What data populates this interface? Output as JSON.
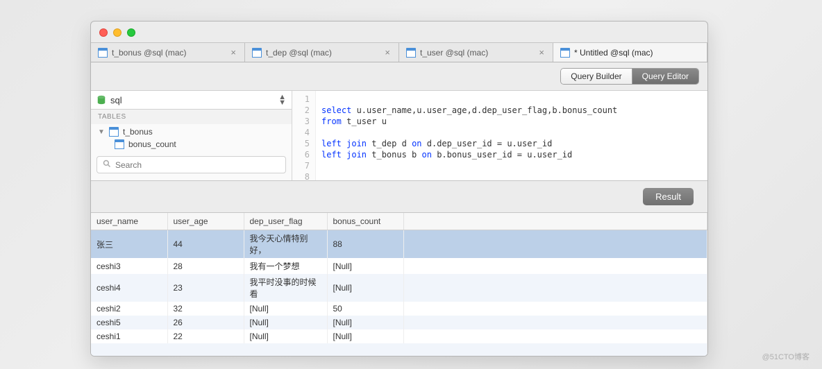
{
  "tabs": [
    {
      "label": "t_bonus @sql (mac)",
      "active": false
    },
    {
      "label": "t_dep @sql (mac)",
      "active": false
    },
    {
      "label": "t_user @sql (mac)",
      "active": false
    },
    {
      "label": "* Untitled @sql (mac)",
      "active": true
    }
  ],
  "toggle": {
    "builder": "Query Builder",
    "editor": "Query Editor"
  },
  "sidebar": {
    "db_name": "sql",
    "section": "TABLES",
    "nodes": {
      "parent": "t_bonus",
      "child": "bonus_count"
    },
    "search_placeholder": "Search"
  },
  "code": {
    "lines": [
      "1",
      "2",
      "3",
      "4",
      "5",
      "6",
      "7",
      "8"
    ],
    "line2_a": "select",
    "line2_b": " u.user_name,u.user_age,d.dep_user_flag,b.bonus_count",
    "line3_a": "from",
    "line3_b": " t_user u",
    "line5_a": "left",
    "line5_b": " join",
    "line5_c": " t_dep d ",
    "line5_d": "on",
    "line5_e": " d.dep_user_id = u.user_id",
    "line6_a": "left",
    "line6_b": " join",
    "line6_c": " t_bonus b ",
    "line6_d": "on",
    "line6_e": " b.bonus_user_id = u.user_id"
  },
  "result_label": "Result",
  "columns": [
    "user_name",
    "user_age",
    "dep_user_flag",
    "bonus_count"
  ],
  "rows": [
    {
      "user_name": "张三",
      "user_age": "44",
      "dep_user_flag": "我今天心情特别好，",
      "bonus_count": "88",
      "selected": true
    },
    {
      "user_name": "ceshi3",
      "user_age": "28",
      "dep_user_flag": "我有一个梦想",
      "bonus_count": "[Null]"
    },
    {
      "user_name": "ceshi4",
      "user_age": "23",
      "dep_user_flag": "我平时没事的时候看",
      "bonus_count": "[Null]"
    },
    {
      "user_name": "ceshi2",
      "user_age": "32",
      "dep_user_flag": "[Null]",
      "bonus_count": "50"
    },
    {
      "user_name": "ceshi5",
      "user_age": "26",
      "dep_user_flag": "[Null]",
      "bonus_count": "[Null]"
    },
    {
      "user_name": "ceshi1",
      "user_age": "22",
      "dep_user_flag": "[Null]",
      "bonus_count": "[Null]"
    }
  ],
  "watermark": "@51CTO博客"
}
